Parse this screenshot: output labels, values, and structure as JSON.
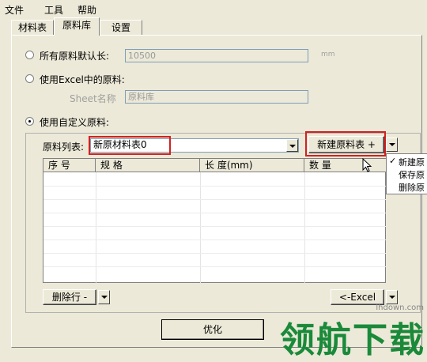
{
  "menu": {
    "items": [
      "文件",
      "工具",
      "帮助"
    ]
  },
  "tabs": [
    "材料表",
    "原料库",
    "设置"
  ],
  "options": {
    "opt1_label": "所有原料默认长:",
    "opt1_value": "10500",
    "opt1_unit": "mm",
    "opt2_label": "使用Excel中的原料:",
    "sheet_label": "Sheet名称",
    "sheet_value": "原料库",
    "opt3_label": "使用自定义原料:"
  },
  "material_list": {
    "label": "原料列表:",
    "value": "新原材料表0",
    "new_button": "新建原料表 +"
  },
  "grid": {
    "columns": [
      "序 号",
      "规 格",
      "长 度(mm)",
      "数 量"
    ],
    "rows": []
  },
  "popup_menu": {
    "items": [
      "新建原",
      "保存原",
      "删除原"
    ],
    "checked": "✓"
  },
  "buttons": {
    "delete_row": "删除行 -",
    "excel": "<-Excel",
    "optimize": "优化"
  },
  "watermark": {
    "text": "领航下载",
    "url": "lhdown.com"
  }
}
